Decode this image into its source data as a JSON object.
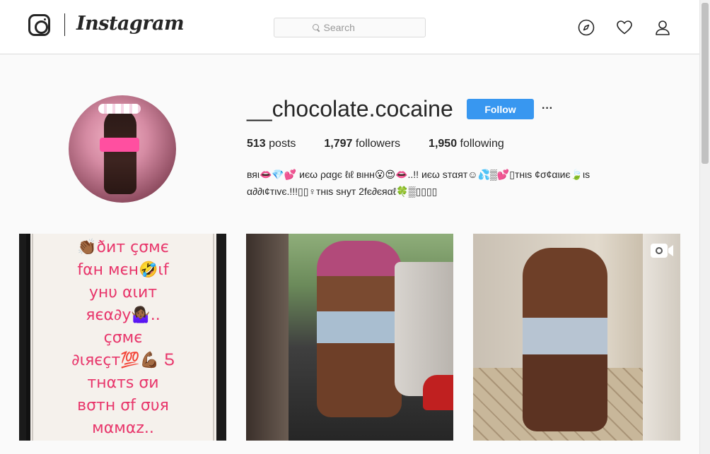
{
  "header": {
    "wordmark": "Instagram",
    "search_placeholder": "Search",
    "icons": [
      "compass-icon",
      "heart-icon",
      "user-icon"
    ]
  },
  "profile": {
    "username": "__chocolate.cocaine",
    "follow_label": "Follow",
    "more_label": "···",
    "stats": {
      "posts_count": "513",
      "posts_label": "posts",
      "followers_count": "1,797",
      "followers_label": "followers",
      "following_count": "1,950",
      "following_label": "following"
    },
    "bio_line1": "вяι👄💎💕 иєω ραgє ℓιℓ вιнн😮😍👄..!! иєω ѕтαят☺💦▒💕▯тнιѕ ¢σ¢αιиє🍃ιѕ",
    "bio_line2": "α∂∂ι¢тιvє.!!!▯▯♀тнιѕ ѕнут 2fє∂єяαℓ🍀▒▯▯▯▯"
  },
  "posts": [
    {
      "type": "image",
      "text_lines": [
        "👏🏾ðит çσмє",
        "fαн мєн🤣ιf",
        "yнυ αιит",
        "яєα∂y🤷🏾‍♀️..",
        "çσмє",
        "∂ιяєçт💯💪🏾 Ƽ",
        "тнαтѕ σи",
        "вσтн σf συя",
        "мαмαz.."
      ]
    },
    {
      "type": "image"
    },
    {
      "type": "video",
      "badge_icon": "video-camera-icon"
    }
  ],
  "colors": {
    "accent": "#3897f0",
    "border": "#dbdbdb",
    "text": "#262626",
    "post1_text": "#e8366b"
  }
}
